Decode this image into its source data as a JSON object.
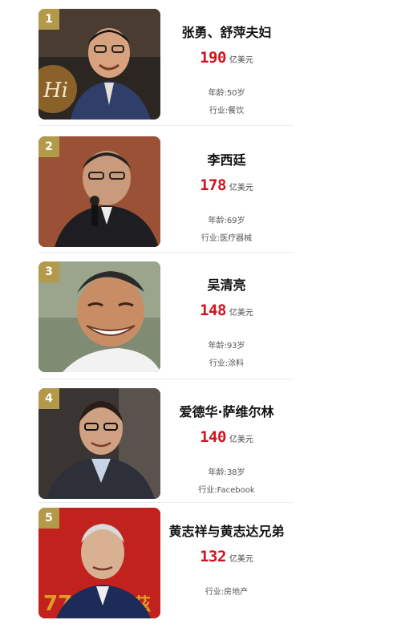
{
  "entries": [
    {
      "rank": "1",
      "name": "张勇、舒萍夫妇",
      "amount": "190",
      "unit": "亿美元",
      "age": "年龄:50岁",
      "industry": "行业:餐饮"
    },
    {
      "rank": "2",
      "name": "李西廷",
      "amount": "178",
      "unit": "亿美元",
      "age": "年龄:69岁",
      "industry": "行业:医疗器械"
    },
    {
      "rank": "3",
      "name": "吴清亮",
      "amount": "148",
      "unit": "亿美元",
      "age": "年龄:93岁",
      "industry": "行业:涂料"
    },
    {
      "rank": "4",
      "name": "爱德华·萨维尔林",
      "amount": "140",
      "unit": "亿美元",
      "age": "年龄:38岁",
      "industry": "行业:Facebook"
    },
    {
      "rank": "5",
      "name": "黄志祥与黄志达兄弟",
      "amount": "132",
      "unit": "亿美元",
      "age": "行业:房地产",
      "industry": ""
    }
  ],
  "colors": {
    "rank_badge": "#b39a4a",
    "amount": "#d0131e"
  }
}
